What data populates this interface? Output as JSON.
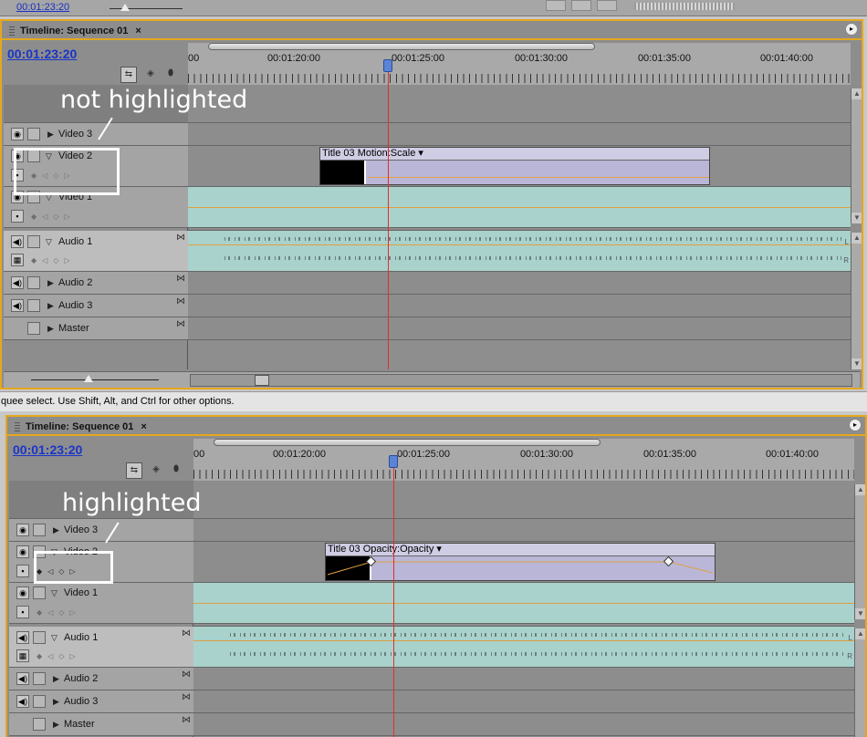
{
  "top_strip": {
    "timecode": "00:01:23:20"
  },
  "status_bar": {
    "text": "quee select. Use Shift, Alt, and Ctrl for other options."
  },
  "panels": [
    {
      "tab_title": "Timeline: Sequence 01",
      "close_glyph": "×",
      "timecode": "00:01:23:20",
      "ruler_labels": [
        "00",
        "00:01:20:00",
        "00:01:25:00",
        "00:01:30:00",
        "00:01:35:00",
        "00:01:40:00"
      ],
      "annotation": "not highlighted",
      "clip_label": "Title 03 Motion:Scale ▾",
      "tracks": [
        {
          "name": "Video 3",
          "kind": "video",
          "expanded": false
        },
        {
          "name": "Video 2",
          "kind": "video",
          "expanded": true
        },
        {
          "name": "Video 1",
          "kind": "video",
          "expanded": true
        },
        {
          "name": "Audio 1",
          "kind": "audio",
          "expanded": true
        },
        {
          "name": "Audio 2",
          "kind": "audio",
          "expanded": false
        },
        {
          "name": "Audio 3",
          "kind": "audio",
          "expanded": false
        },
        {
          "name": "Master",
          "kind": "master",
          "expanded": false
        }
      ]
    },
    {
      "tab_title": "Timeline: Sequence 01",
      "close_glyph": "×",
      "timecode": "00:01:23:20",
      "ruler_labels": [
        "00",
        "00:01:20:00",
        "00:01:25:00",
        "00:01:30:00",
        "00:01:35:00",
        "00:01:40:00"
      ],
      "annotation": "highlighted",
      "clip_label": "Title 03 Opacity:Opacity ▾",
      "tracks": [
        {
          "name": "Video 3",
          "kind": "video",
          "expanded": false
        },
        {
          "name": "Video 2",
          "kind": "video",
          "expanded": true
        },
        {
          "name": "Video 1",
          "kind": "video",
          "expanded": true
        },
        {
          "name": "Audio 1",
          "kind": "audio",
          "expanded": true
        },
        {
          "name": "Audio 2",
          "kind": "audio",
          "expanded": false
        },
        {
          "name": "Audio 3",
          "kind": "audio",
          "expanded": false
        },
        {
          "name": "Master",
          "kind": "master",
          "expanded": false
        }
      ]
    }
  ],
  "audio_channel_labels": [
    "L",
    "R"
  ],
  "icons": {
    "eye": "eye-icon",
    "speaker": "speaker-icon",
    "lock": "lock-icon",
    "expand": "expand-triangle-icon",
    "keyframe_nav": "keyframe-navigator-icon",
    "snap": "snap-icon",
    "marker": "marker-icon",
    "sync": "sync-lock-icon"
  }
}
